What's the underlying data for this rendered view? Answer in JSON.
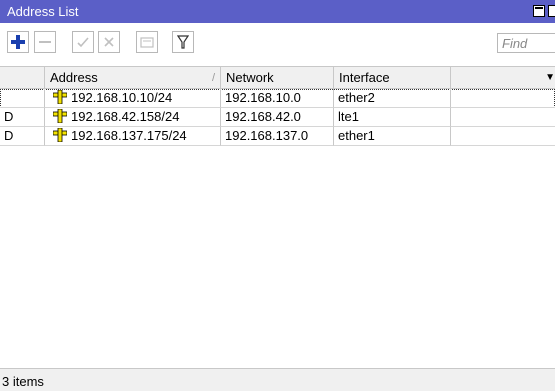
{
  "window": {
    "title": "Address List",
    "titlebar_color": "#5b5fc7"
  },
  "toolbar": {
    "buttons": [
      {
        "name": "add",
        "icon": "plus-icon",
        "enabled": true,
        "color": "#1a3fae"
      },
      {
        "name": "remove",
        "icon": "minus-icon",
        "enabled": false
      },
      {
        "name": "enable",
        "icon": "check-icon",
        "enabled": false
      },
      {
        "name": "disable",
        "icon": "cross-icon",
        "enabled": false
      },
      {
        "name": "comment",
        "icon": "comment-icon",
        "enabled": false
      },
      {
        "name": "filter",
        "icon": "filter-icon",
        "enabled": true
      }
    ],
    "find_placeholder": "Find"
  },
  "table": {
    "columns": [
      "",
      "Address",
      "Network",
      "Interface",
      ""
    ],
    "rows": [
      {
        "flag": "",
        "address": "192.168.10.10/24",
        "network": "192.168.10.0",
        "interface": "ether2",
        "selected": true
      },
      {
        "flag": "D",
        "address": "192.168.42.158/24",
        "network": "192.168.42.0",
        "interface": "lte1",
        "selected": false
      },
      {
        "flag": "D",
        "address": "192.168.137.175/24",
        "network": "192.168.137.0",
        "interface": "ether1",
        "selected": false
      }
    ]
  },
  "status": {
    "text": "3 items"
  }
}
